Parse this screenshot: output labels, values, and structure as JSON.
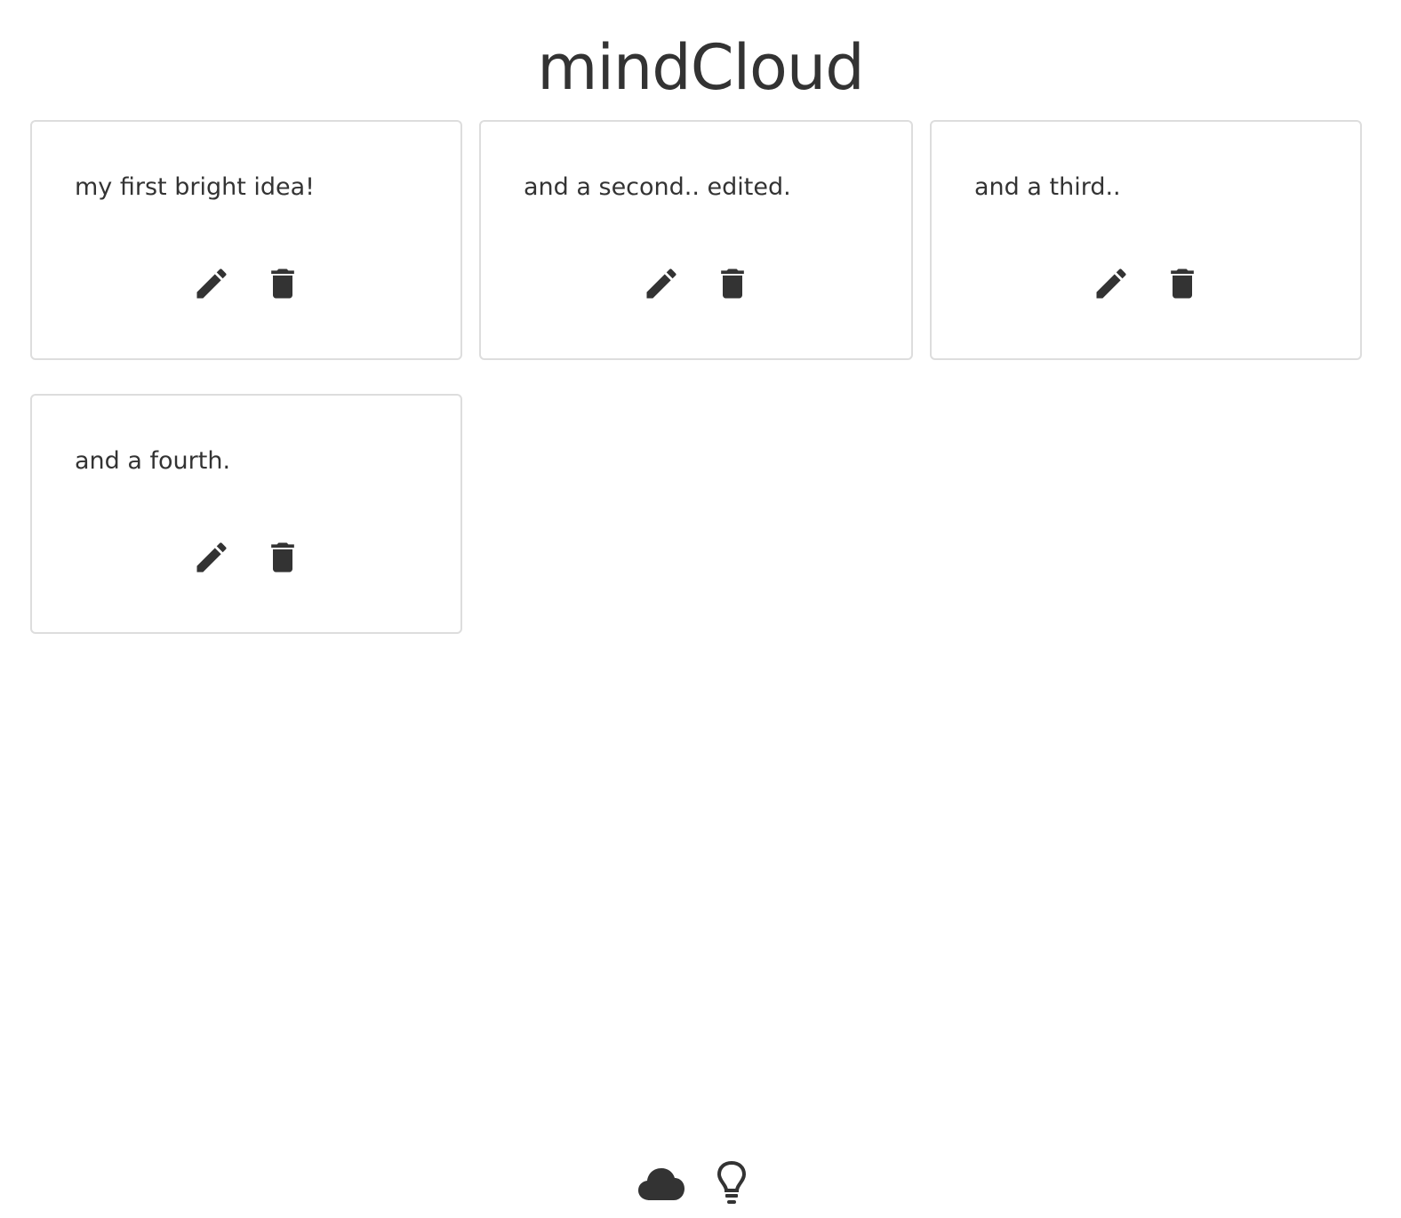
{
  "header": {
    "title": "mindCloud"
  },
  "ideas": [
    {
      "text": "my first bright idea!",
      "edit_icon": "pencil-icon",
      "delete_icon": "trash-icon"
    },
    {
      "text": "and a second.. edited.",
      "edit_icon": "pencil-icon",
      "delete_icon": "trash-icon"
    },
    {
      "text": "and a third..",
      "edit_icon": "pencil-icon",
      "delete_icon": "trash-icon"
    },
    {
      "text": "and a fourth.",
      "edit_icon": "pencil-icon",
      "delete_icon": "trash-icon"
    }
  ],
  "footer": {
    "icons": [
      "cloud-icon",
      "lightbulb-icon"
    ]
  },
  "colors": {
    "text": "#333333",
    "card_border": "#dddddd",
    "background": "#ffffff"
  }
}
